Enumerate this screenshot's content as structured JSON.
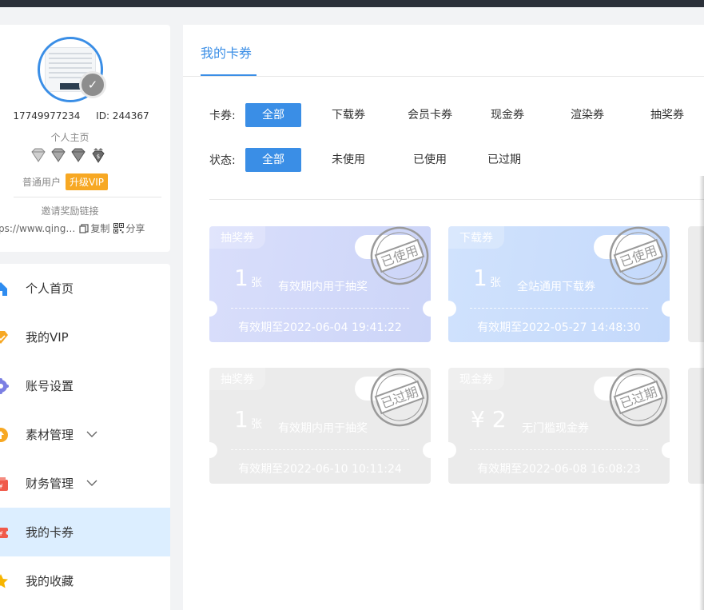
{
  "profile": {
    "phone": "17749977234",
    "id_text": "ID: 244367",
    "homepage_label": "个人主页",
    "user_level": "普通用户",
    "upgrade_label": "升级VIP",
    "invite_title": "邀请奖励链接",
    "invite_link": "ps://www.qing…",
    "copy_label": "复制",
    "share_label": "分享"
  },
  "menu": {
    "items": [
      {
        "label": "个人首页",
        "icon": "home-icon",
        "color": "#2f8cf0"
      },
      {
        "label": "我的VIP",
        "icon": "vip-diamond-icon",
        "color": "#f7a823"
      },
      {
        "label": "账号设置",
        "icon": "gear-icon",
        "color": "#7b7fe3"
      },
      {
        "label": "素材管理",
        "icon": "upload-circle-icon",
        "color": "#f7a823"
      },
      {
        "label": "财务管理",
        "icon": "wallet-icon",
        "color": "#f05a4a"
      },
      {
        "label": "我的卡券",
        "icon": "coupon-icon",
        "color": "#f05a4a"
      },
      {
        "label": "我的收藏",
        "icon": "star-icon",
        "color": "#f7b500"
      }
    ],
    "active_index": 5
  },
  "main": {
    "tab_title": "我的卡券",
    "type_filter": {
      "label": "卡券:",
      "options": [
        "全部",
        "下载券",
        "会员卡券",
        "现金券",
        "渲染券",
        "抽奖券"
      ],
      "selected": "全部"
    },
    "status_filter": {
      "label": "状态:",
      "options": [
        "全部",
        "未使用",
        "已使用",
        "已过期"
      ],
      "selected": "全部"
    },
    "coupons": [
      {
        "type": "抽奖券",
        "amount": "1",
        "unit": "张",
        "desc": "有效期内用于抽奖",
        "expiry": "有效期至2022-06-04 19:41:22",
        "stamp": "已使用"
      },
      {
        "type": "下载券",
        "amount": "1",
        "unit": "张",
        "desc": "全站通用下载券",
        "expiry": "有效期至2022-05-27 14:48:30",
        "stamp": "已使用"
      },
      {
        "type": "抽奖券",
        "amount": "1",
        "unit": "张",
        "desc": "有效期内用于抽奖",
        "expiry": "有效期至2022-06-10 10:11:24",
        "stamp": "已过期"
      },
      {
        "type": "现金券",
        "amount": "¥ 2",
        "unit": "",
        "desc": "无门槛现金券",
        "expiry": "有效期至2022-06-08 16:08:23",
        "stamp": "已过期"
      }
    ]
  },
  "colors": {
    "accent": "#3a8ee6",
    "vip": "#f7a823",
    "active_menu_bg": "#dceeff",
    "used_coupon_1": "#d3d9fa",
    "used_coupon_2": "#c9ddfc",
    "expired_coupon": "#ebebeb"
  }
}
